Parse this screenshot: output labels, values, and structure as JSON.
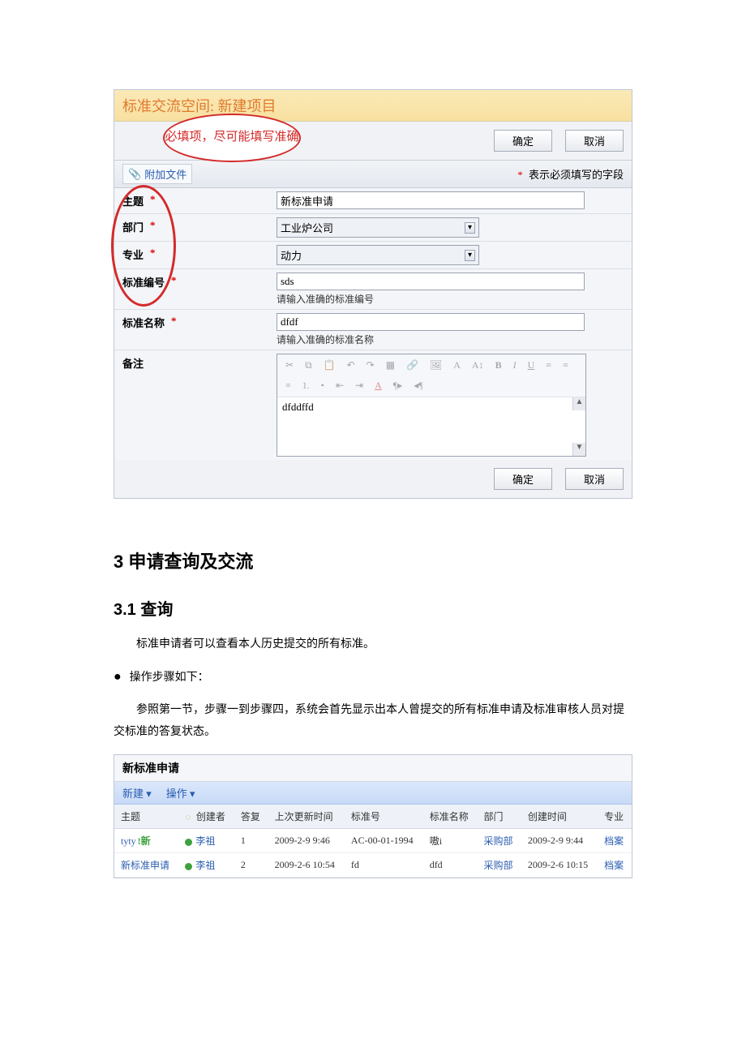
{
  "form": {
    "title_prefix": "标准交流空间:",
    "title_action": "新建项目",
    "callout": "必填项，尽可能填写准确",
    "attach": "附加文件",
    "required_note": "表示必须填写的字段",
    "confirm": "确定",
    "cancel": "取消",
    "fields": {
      "subject": {
        "label": "主题",
        "value": "新标准申请"
      },
      "dept": {
        "label": "部门",
        "value": "工业炉公司"
      },
      "major": {
        "label": "专业",
        "value": "动力"
      },
      "std_no": {
        "label": "标准编号",
        "value": "sds",
        "hint": "请输入准确的标准编号"
      },
      "std_name": {
        "label": "标准名称",
        "value": "dfdf",
        "hint": "请输入准确的标准名称"
      },
      "remark": {
        "label": "备注",
        "value": "dfddffd"
      }
    }
  },
  "doc": {
    "h3": "3 申请查询及交流",
    "h31": "3.1 查询",
    "p1": "标准申请者可以查看本人历史提交的所有标准。",
    "b1": "操作步骤如下：",
    "p2": "参照第一节，步骤一到步骤四，系统会首先显示出本人曾提交的所有标准申请及标准审核人员对提交标准的答复状态。"
  },
  "list": {
    "title": "新标准申请",
    "toolbar": {
      "new": "新建 ▾",
      "ops": "操作 ▾"
    },
    "columns": {
      "subject": "主题",
      "creator": "创建者",
      "replies": "答复",
      "updated": "上次更新时间",
      "std_no": "标准号",
      "std_name": "标准名称",
      "dept": "部门",
      "created": "创建时间",
      "major": "专业"
    },
    "rows": [
      {
        "subject": "tyty",
        "is_new": true,
        "new_tag": "!新",
        "creator": "李祖",
        "replies": "1",
        "updated": "2009-2-9 9:46",
        "std_no": "AC-00-01-1994",
        "std_name": "嗷i",
        "dept": "采购部",
        "created": "2009-2-9 9:44",
        "major": "档案"
      },
      {
        "subject": "新标准申请",
        "is_new": false,
        "new_tag": "",
        "creator": "李祖",
        "replies": "2",
        "updated": "2009-2-6 10:54",
        "std_no": "fd",
        "std_name": "dfd",
        "dept": "采购部",
        "created": "2009-2-6 10:15",
        "major": "档案"
      }
    ]
  }
}
